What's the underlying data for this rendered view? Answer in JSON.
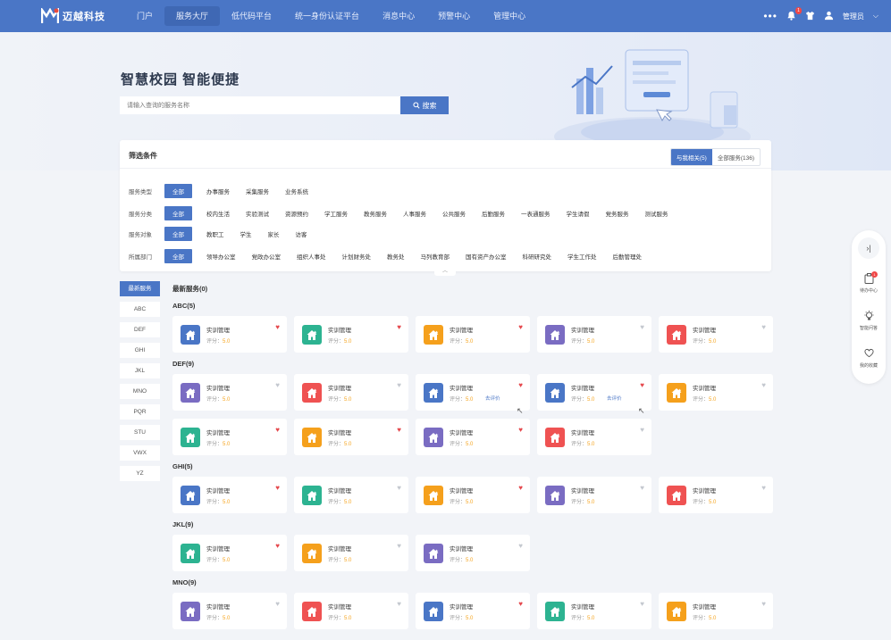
{
  "header": {
    "logo_text": "迈越科技",
    "nav": [
      "门户",
      "服务大厅",
      "低代码平台",
      "统一身份认证平台",
      "消息中心",
      "预警中心",
      "管理中心"
    ],
    "active_nav": 1,
    "more": "•••",
    "notification_count": "1",
    "user_name": "管理员",
    "brand_color": "#4a76c6"
  },
  "hero": {
    "title": "智慧校园 智能便捷",
    "search_placeholder": "请输入查询的服务名称",
    "search_button": "搜索"
  },
  "filter": {
    "title": "筛选条件",
    "toggle_related": "与我相关(5)",
    "toggle_all": "全部服务(136)",
    "rows": [
      {
        "label": "服务类型",
        "options": [
          "全部",
          "办事服务",
          "采集服务",
          "业务系统"
        ]
      },
      {
        "label": "服务分类",
        "options": [
          "全部",
          "校内生活",
          "实验测试",
          "资源预约",
          "学工服务",
          "教务服务",
          "人事服务",
          "公共服务",
          "后勤服务",
          "一表通服务",
          "学生请假",
          "党务服务",
          "测试服务"
        ]
      },
      {
        "label": "服务对象",
        "options": [
          "全部",
          "教职工",
          "学生",
          "家长",
          "访客"
        ]
      },
      {
        "label": "所属部门",
        "options": [
          "全部",
          "领导办公室",
          "党政办公室",
          "组织人事处",
          "计划财务处",
          "教务处",
          "马列教育部",
          "国有资产办公室",
          "科研研究处",
          "学生工作处",
          "后勤管理处"
        ]
      }
    ],
    "collapse": "︿"
  },
  "letters": [
    "最新服务",
    "ABC",
    "DEF",
    "GHI",
    "JKL",
    "MNO",
    "PQR",
    "STU",
    "VWX",
    "YZ"
  ],
  "latest_heading": "最新服务(0)",
  "card_name": "实训管理",
  "score_label": "评分：",
  "score_value": "5.0",
  "eval_label": "去评价",
  "sections": [
    {
      "title": "ABC(5)",
      "cards": [
        {
          "color": "#4a76c6",
          "fav": true
        },
        {
          "color": "#2db391",
          "fav": true
        },
        {
          "color": "#f5a01c",
          "fav": true
        },
        {
          "color": "#7a6cc2",
          "fav": false
        },
        {
          "color": "#ef5252",
          "fav": false
        }
      ]
    },
    {
      "title": "DEF(9)",
      "cards": [
        {
          "color": "#7a6cc2",
          "fav": false
        },
        {
          "color": "#ef5252",
          "fav": false
        },
        {
          "color": "#4a76c6",
          "fav": true,
          "eval": true
        },
        {
          "color": "#4a76c6",
          "fav": true,
          "eval": true
        },
        {
          "color": "#f5a01c",
          "fav": false
        },
        {
          "color": "#2db391",
          "fav": true
        },
        {
          "color": "#f5a01c",
          "fav": true
        },
        {
          "color": "#7a6cc2",
          "fav": true
        },
        {
          "color": "#ef5252",
          "fav": false
        }
      ]
    },
    {
      "title": "GHI(5)",
      "cards": [
        {
          "color": "#4a76c6",
          "fav": true
        },
        {
          "color": "#2db391",
          "fav": false
        },
        {
          "color": "#f5a01c",
          "fav": true
        },
        {
          "color": "#7a6cc2",
          "fav": false
        },
        {
          "color": "#ef5252",
          "fav": false
        }
      ]
    },
    {
      "title": "JKL(9)",
      "cards": [
        {
          "color": "#2db391",
          "fav": true
        },
        {
          "color": "#f5a01c",
          "fav": false
        },
        {
          "color": "#7a6cc2",
          "fav": false
        }
      ]
    },
    {
      "title": "MNO(9)",
      "cards": [
        {
          "color": "#7a6cc2",
          "fav": false
        },
        {
          "color": "#ef5252",
          "fav": false
        },
        {
          "color": "#4a76c6",
          "fav": true
        },
        {
          "color": "#2db391",
          "fav": false
        },
        {
          "color": "#f5a01c",
          "fav": false
        }
      ]
    }
  ],
  "side": {
    "close": "›|",
    "todo_label": "待办中心",
    "todo_count": "1",
    "suggest_label": "智能问答",
    "fav_label": "我的收藏"
  }
}
